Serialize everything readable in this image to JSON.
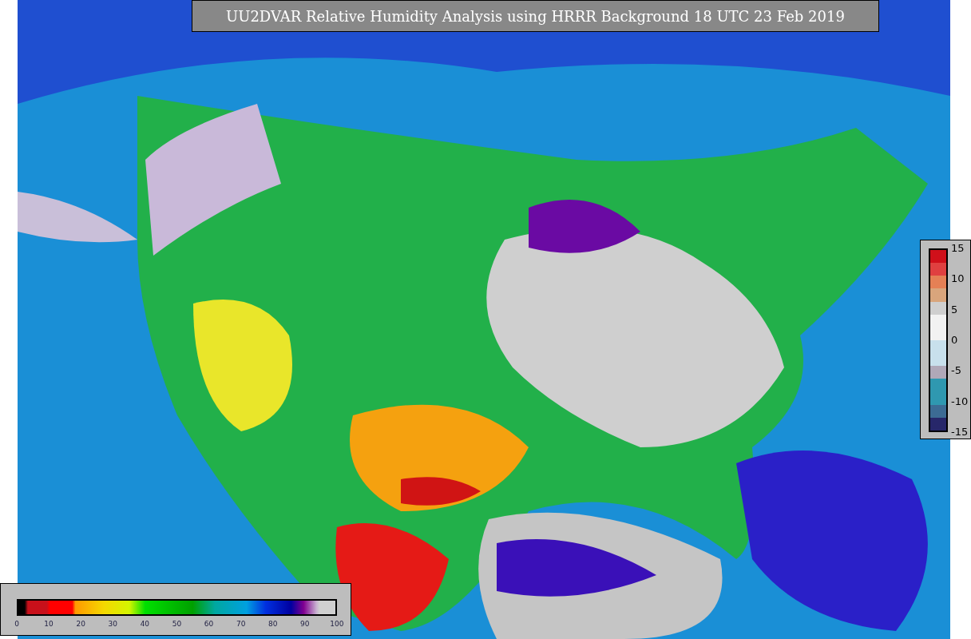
{
  "title": "UU2DVAR Relative Humidity Analysis using HRRR Background 18 UTC 23 Feb 2019",
  "humidity_colorbar": {
    "ticks": [
      "0",
      "10",
      "20",
      "30",
      "40",
      "50",
      "60",
      "70",
      "80",
      "90",
      "100"
    ]
  },
  "difference_colorbar": {
    "ticks": [
      "15",
      "10",
      "5",
      "0",
      "-5",
      "-10",
      "-15"
    ]
  }
}
